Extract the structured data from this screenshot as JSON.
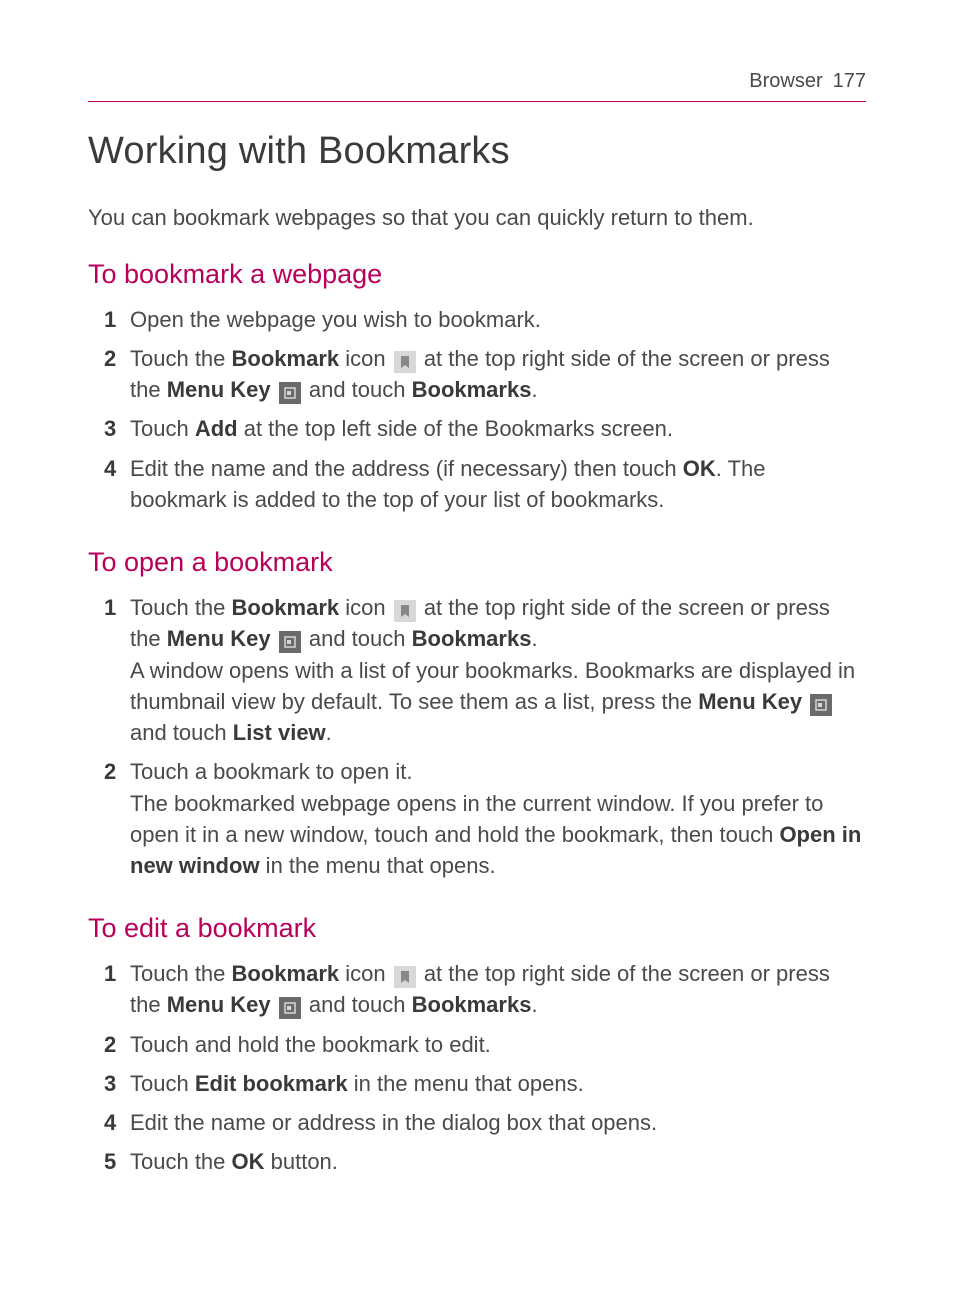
{
  "header": {
    "section": "Browser",
    "page": "177"
  },
  "title": "Working with Bookmarks",
  "intro": "You can bookmark webpages so that you can quickly return to them.",
  "s1": {
    "heading": "To bookmark a webpage",
    "step1": "Open the webpage you wish to bookmark.",
    "step2a": "Touch the ",
    "step2_bold1": "Bookmark",
    "step2b": " icon ",
    "step2c": " at the top right side of the screen or press the ",
    "step2_bold2": "Menu Key",
    "step2d": " and touch ",
    "step2_bold3": "Bookmarks",
    "step2e": ".",
    "step3a": "Touch ",
    "step3_bold1": "Add",
    "step3b": " at the top left side of the Bookmarks screen.",
    "step4a": "Edit the name and the address (if necessary) then touch ",
    "step4_bold1": "OK",
    "step4b": ". The bookmark is added to the top of your list of bookmarks."
  },
  "s2": {
    "heading": "To open a bookmark",
    "step1a": "Touch the ",
    "step1_bold1": "Bookmark",
    "step1b": " icon ",
    "step1c": " at the top right side of the screen or press the ",
    "step1_bold2": "Menu Key",
    "step1d": " and touch ",
    "step1_bold3": "Bookmarks",
    "step1e": ".",
    "step1f": "A window opens with a list of your bookmarks. Bookmarks are displayed in thumbnail view by default. To see them as a list, press the ",
    "step1_bold4": "Menu Key",
    "step1g": " and touch ",
    "step1_bold5": "List view",
    "step1h": ".",
    "step2a": "Touch a bookmark to open it.",
    "step2b": "The bookmarked webpage opens in the current window. If you prefer to open it in a new window, touch and hold the bookmark, then touch ",
    "step2_bold1": "Open in new window",
    "step2c": " in the menu that opens."
  },
  "s3": {
    "heading": "To edit a bookmark",
    "step1a": "Touch the ",
    "step1_bold1": "Bookmark",
    "step1b": " icon ",
    "step1c": " at the top right side of the screen or press the ",
    "step1_bold2": "Menu Key",
    "step1d": " and touch ",
    "step1_bold3": "Bookmarks",
    "step1e": ".",
    "step2": "Touch and hold the bookmark to edit.",
    "step3a": "Touch ",
    "step3_bold1": "Edit bookmark",
    "step3b": " in the menu that opens.",
    "step4": "Edit the name or address in the dialog box that opens.",
    "step5a": "Touch the ",
    "step5_bold1": "OK",
    "step5b": " button."
  }
}
